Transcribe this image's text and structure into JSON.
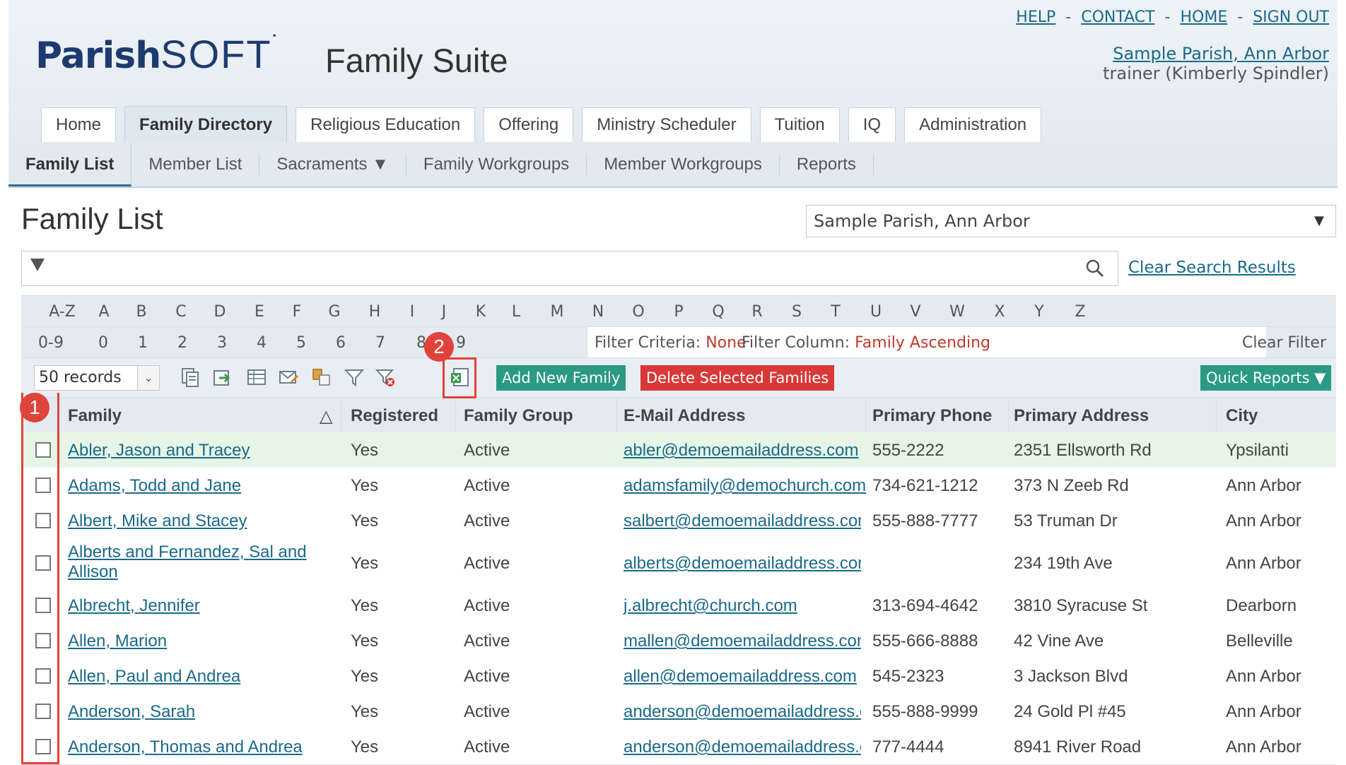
{
  "header": {
    "logo_bold": "Parish",
    "logo_light": "SOFT",
    "logo_mark": "•",
    "suite_title": "Family Suite",
    "top_links": [
      "HELP",
      "CONTACT",
      "HOME",
      "SIGN OUT"
    ],
    "link_separator": "-",
    "parish_link": "Sample Parish, Ann Arbor",
    "user_line": "trainer (Kimberly Spindler)"
  },
  "main_tabs": [
    {
      "label": "Home"
    },
    {
      "label": "Family Directory",
      "active": true
    },
    {
      "label": "Religious Education"
    },
    {
      "label": "Offering"
    },
    {
      "label": "Ministry Scheduler"
    },
    {
      "label": "Tuition"
    },
    {
      "label": "IQ"
    },
    {
      "label": "Administration"
    }
  ],
  "sub_nav": [
    {
      "label": "Family List",
      "active": true
    },
    {
      "label": "Member List"
    },
    {
      "label": "Sacraments ▼"
    },
    {
      "label": "Family Workgroups"
    },
    {
      "label": "Member Workgroups"
    },
    {
      "label": "Reports"
    }
  ],
  "page_title": "Family List",
  "parish_select": {
    "value": "Sample Parish, Ann Arbor",
    "caret": "▼"
  },
  "search": {
    "placeholder": "",
    "clear_label": "Clear Search Results"
  },
  "alphabet": [
    "A-Z",
    "A",
    "B",
    "C",
    "D",
    "E",
    "F",
    "G",
    "H",
    "I",
    "J",
    "K",
    "L",
    "M",
    "N",
    "O",
    "P",
    "Q",
    "R",
    "S",
    "T",
    "U",
    "V",
    "W",
    "X",
    "Y",
    "Z"
  ],
  "numbers": [
    "0-9",
    "0",
    "1",
    "2",
    "3",
    "4",
    "5",
    "6",
    "7",
    "8",
    "9"
  ],
  "filter": {
    "criteria_label": "Filter Criteria:",
    "criteria_value": "None",
    "column_label": "Filter Column:",
    "column_value": "Family Ascending",
    "clear_label": "Clear Filter"
  },
  "toolbar": {
    "records_value": "50 records",
    "icons": [
      "copy-icon",
      "export-icon",
      "grid-icon",
      "email-icon",
      "merge-icon",
      "filter-icon",
      "clear-filter-icon",
      "excel-export-icon"
    ],
    "add_label": "Add New Family",
    "delete_label": "Delete Selected Families",
    "quick_reports_label": "Quick Reports ▼"
  },
  "callouts": [
    "1",
    "2"
  ],
  "colors": {
    "accent_link": "#1a6a8a",
    "green_button": "#2a9a85",
    "red_button": "#d93838",
    "callout": "#e0433a",
    "highlight_row": "#e6f5e6"
  },
  "table": {
    "columns": [
      {
        "label": "Family",
        "sort": "△"
      },
      {
        "label": "Registered"
      },
      {
        "label": "Family Group"
      },
      {
        "label": "E-Mail Address"
      },
      {
        "label": "Primary Phone"
      },
      {
        "label": "Primary Address"
      },
      {
        "label": "City"
      }
    ],
    "rows": [
      {
        "family": "Abler, Jason and Tracey",
        "registered": "Yes",
        "group": "Active",
        "email": "abler@demoemailaddress.com",
        "phone": "555-2222",
        "address": "2351 Ellsworth Rd",
        "city": "Ypsilanti"
      },
      {
        "family": "Adams, Todd and Jane",
        "registered": "Yes",
        "group": "Active",
        "email": "adamsfamily@demochurch.com",
        "phone": "734-621-1212",
        "address": "373 N Zeeb Rd",
        "city": "Ann Arbor"
      },
      {
        "family": "Albert, Mike and Stacey",
        "registered": "Yes",
        "group": "Active",
        "email": "salbert@demoemailaddress.com",
        "phone": "555-888-7777",
        "address": "53 Truman Dr",
        "city": "Ann Arbor"
      },
      {
        "family": "Alberts and Fernandez, Sal and",
        "family2": "Allison",
        "registered": "Yes",
        "group": "Active",
        "email": "alberts@demoemailaddress.com",
        "phone": "",
        "address": "234 19th Ave",
        "city": "Ann Arbor"
      },
      {
        "family": "Albrecht, Jennifer",
        "registered": "Yes",
        "group": "Active",
        "email": "j.albrecht@church.com",
        "phone": "313-694-4642",
        "address": "3810 Syracuse St",
        "city": "Dearborn"
      },
      {
        "family": "Allen, Marion",
        "registered": "Yes",
        "group": "Active",
        "email": "mallen@demoemailaddress.com",
        "phone": "555-666-8888",
        "address": "42 Vine Ave",
        "city": "Belleville"
      },
      {
        "family": "Allen, Paul and Andrea",
        "registered": "Yes",
        "group": "Active",
        "email": "allen@demoemailaddress.com",
        "phone": "545-2323",
        "address": "3 Jackson Blvd",
        "city": "Ann Arbor"
      },
      {
        "family": "Anderson, Sarah",
        "registered": "Yes",
        "group": "Active",
        "email": "anderson@demoemailaddress.com",
        "phone": "555-888-9999",
        "address": "24 Gold Pl #45",
        "city": "Ann Arbor"
      },
      {
        "family": "Anderson, Thomas and Andrea",
        "registered": "Yes",
        "group": "Active",
        "email": "anderson@demoemailaddress.com",
        "phone": "777-4444",
        "address": "8941 River Road",
        "city": "Ann Arbor"
      }
    ]
  }
}
